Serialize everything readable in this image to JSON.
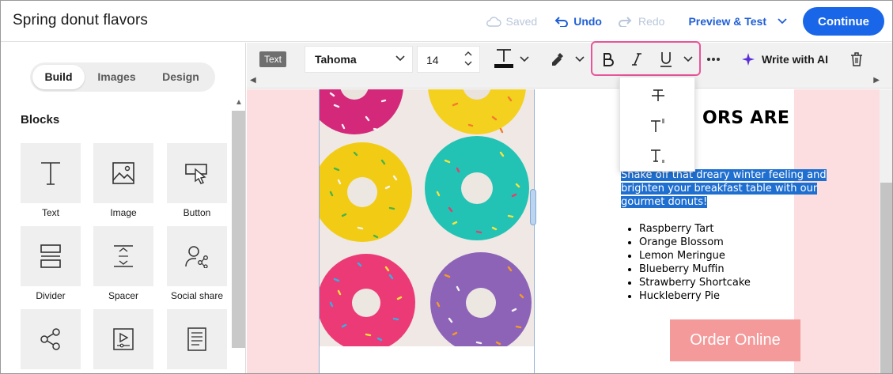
{
  "app": {
    "doc_title": "Spring donut flavors",
    "status_saved": "Saved",
    "undo_label": "Undo",
    "redo_label": "Redo",
    "preview_label": "Preview & Test",
    "continue_label": "Continue"
  },
  "sidebar": {
    "tabs": [
      "Build",
      "Images",
      "Design"
    ],
    "active_tab": "Build",
    "section_title": "Blocks",
    "blocks": [
      {
        "label": "Text",
        "icon": "text-icon"
      },
      {
        "label": "Image",
        "icon": "image-icon"
      },
      {
        "label": "Button",
        "icon": "button-icon"
      },
      {
        "label": "Divider",
        "icon": "divider-icon"
      },
      {
        "label": "Spacer",
        "icon": "spacer-icon"
      },
      {
        "label": "Social share",
        "icon": "social-share-icon"
      },
      {
        "label": "",
        "icon": "share-icon"
      },
      {
        "label": "",
        "icon": "video-icon"
      },
      {
        "label": "",
        "icon": "document-icon"
      }
    ]
  },
  "toolbar": {
    "block_type_badge": "Text",
    "font_family": "Tahoma",
    "font_size": "14",
    "ai_label": "Write with AI"
  },
  "email": {
    "headline": "SPRIN ORS ARE",
    "body": "Shake off that dreary winter feeling and brighten your breakfast table with our gourmet donuts!",
    "flavors": [
      "Raspberry Tart",
      "Orange Blossom",
      "Lemon Meringue",
      "Blueberry Muffin",
      "Strawberry Shortcake",
      "Huckleberry Pie"
    ],
    "cta_label": "Order Online"
  },
  "format_menu": [
    "strikethrough-icon",
    "superscript-icon",
    "subscript-icon"
  ],
  "colors": {
    "accent": "#1a66e8",
    "highlight_border": "#e8559a",
    "canvas_bg": "#fcdde0",
    "cta_bg": "#f49a9a",
    "selection": "#1f6fd0"
  }
}
